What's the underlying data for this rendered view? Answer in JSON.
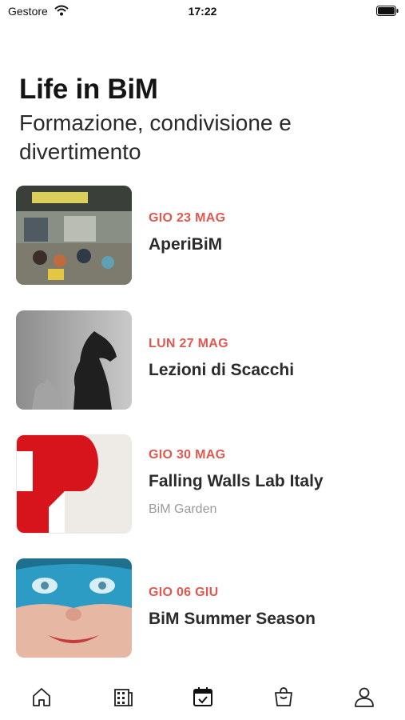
{
  "status_bar": {
    "carrier": "Gestore",
    "time": "17:22"
  },
  "header": {
    "title": "Life in BiM",
    "subtitle": "Formazione, condivisione e divertimento"
  },
  "events": [
    {
      "date": "GIO 23 MAG",
      "title": "AperiBiM",
      "place": ""
    },
    {
      "date": "LUN 27 MAG",
      "title": "Lezioni di Scacchi",
      "place": ""
    },
    {
      "date": "GIO 30 MAG",
      "title": "Falling Walls Lab Italy",
      "place": "BiM Garden"
    },
    {
      "date": "GIO 06 GIU",
      "title": "BiM Summer Season",
      "place": ""
    }
  ],
  "tab_bar": {
    "icons": [
      "home-icon",
      "building-icon",
      "calendar-icon",
      "bag-icon",
      "profile-icon"
    ],
    "selected": 2
  },
  "colors": {
    "accent": "#e0584f",
    "text": "#2b2b2b",
    "muted": "#9a9a9a"
  }
}
